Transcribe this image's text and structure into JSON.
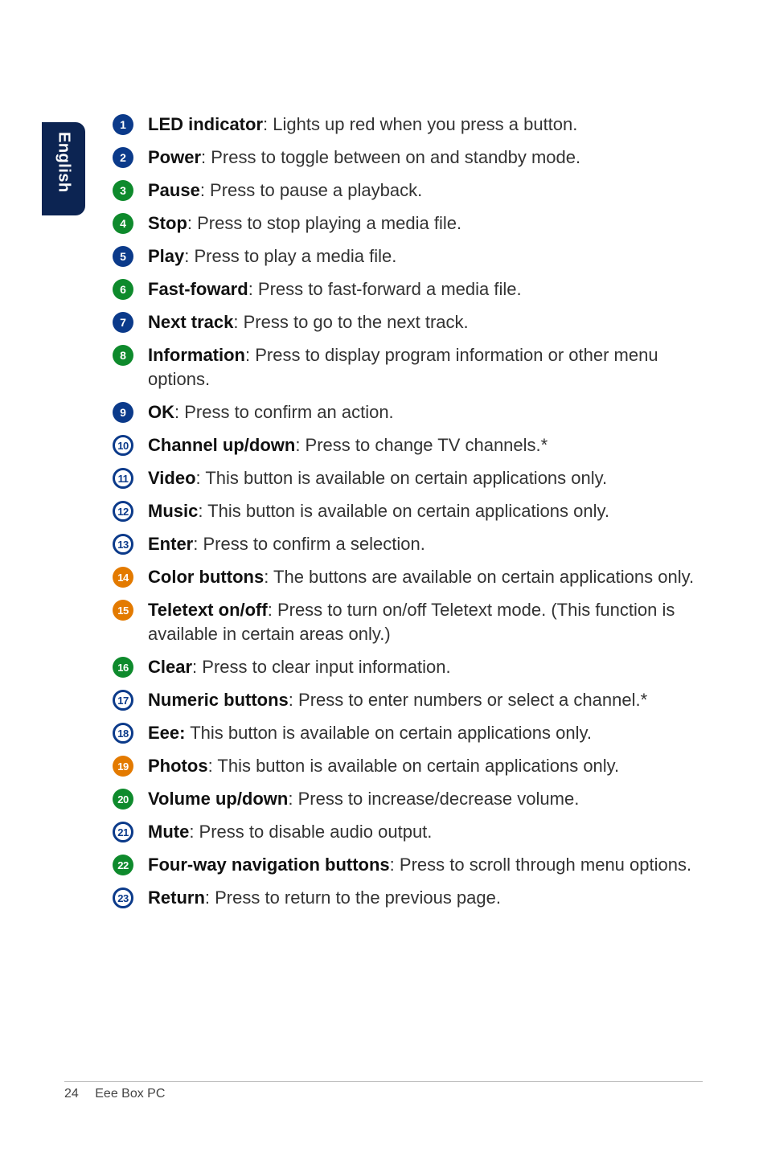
{
  "side_label": "English",
  "items": [
    {
      "num": "1",
      "cls": "badge-blue",
      "title": "LED indicator",
      "desc": ": Lights up red when you press a button."
    },
    {
      "num": "2",
      "cls": "badge-blue",
      "title": "Power",
      "desc": ": Press to toggle between on and standby mode."
    },
    {
      "num": "3",
      "cls": "badge-green",
      "title": "Pause",
      "desc": ": Press to pause a playback."
    },
    {
      "num": "4",
      "cls": "badge-green",
      "title": "Stop",
      "desc": ": Press to stop playing a media file."
    },
    {
      "num": "5",
      "cls": "badge-blue",
      "title": "Play",
      "desc": ": Press to play a media file."
    },
    {
      "num": "6",
      "cls": "badge-green",
      "title": "Fast-foward",
      "desc": ": Press to fast-forward a media file."
    },
    {
      "num": "7",
      "cls": "badge-blue",
      "title": "Next track",
      "desc": ": Press to go to the next track."
    },
    {
      "num": "8",
      "cls": "badge-green",
      "title": "Information",
      "desc": ": Press to display program information or other menu options."
    },
    {
      "num": "9",
      "cls": "badge-blue",
      "title": "OK",
      "desc": ": Press to confirm an action."
    },
    {
      "num": "10",
      "cls": "badge-blue-outline",
      "title": "Channel up/down",
      "desc": ": Press to change TV channels.*"
    },
    {
      "num": "11",
      "cls": "badge-blue-outline",
      "title": "Video",
      "desc": ": This button is available on certain applications only."
    },
    {
      "num": "12",
      "cls": "badge-blue-outline",
      "title": "Music",
      "desc": ": This button is available on certain applications only."
    },
    {
      "num": "13",
      "cls": "badge-blue-outline",
      "title": "Enter",
      "desc": ": Press to confirm a selection."
    },
    {
      "num": "14",
      "cls": "badge-orange",
      "title": "Color buttons",
      "desc": ": The buttons are available on certain applications only."
    },
    {
      "num": "15",
      "cls": "badge-orange",
      "title": "Teletext on/off",
      "desc": ": Press to turn on/off Teletext mode. (This function is available in certain areas only.)"
    },
    {
      "num": "16",
      "cls": "badge-green",
      "title": "Clear",
      "desc": ": Press to clear input information."
    },
    {
      "num": "17",
      "cls": "badge-blue-outline",
      "title": "Numeric buttons",
      "desc": ": Press to enter numbers or select a channel.*"
    },
    {
      "num": "18",
      "cls": "badge-blue-outline",
      "title": "Eee:",
      "desc": " This button is available on certain applications only."
    },
    {
      "num": "19",
      "cls": "badge-orange",
      "title": "Photos",
      "desc": ": This button is available on certain applications only."
    },
    {
      "num": "20",
      "cls": "badge-green",
      "title": "Volume up/down",
      "desc": ": Press to increase/decrease volume."
    },
    {
      "num": "21",
      "cls": "badge-blue-outline",
      "title": "Mute",
      "desc": ": Press to disable audio output."
    },
    {
      "num": "22",
      "cls": "badge-green",
      "title": "Four-way navigation buttons",
      "desc": ": Press to scroll through menu options."
    },
    {
      "num": "23",
      "cls": "badge-blue-outline",
      "title": "Return",
      "desc": ": Press to return to the previous page."
    }
  ],
  "footer": {
    "page": "24",
    "title": "Eee Box PC"
  }
}
